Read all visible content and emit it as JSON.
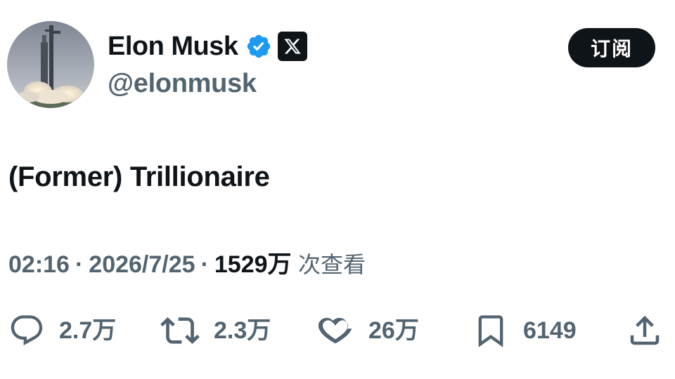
{
  "author": {
    "name": "Elon Musk",
    "handle": "@elonmusk",
    "x_badge": "𝕏"
  },
  "subscribe_label": "订阅",
  "tweet": {
    "text": "(Former) Trillionaire",
    "time": "02:16",
    "separator": "·",
    "date": "2026/7/25",
    "views": "1529万",
    "views_suffix": "次查看"
  },
  "actions": {
    "replies": "2.7万",
    "reposts": "2.3万",
    "likes": "26万",
    "bookmarks": "6149"
  },
  "colors": {
    "text": "#0f1419",
    "secondary": "#536471",
    "verified": "#1d9bf0"
  }
}
